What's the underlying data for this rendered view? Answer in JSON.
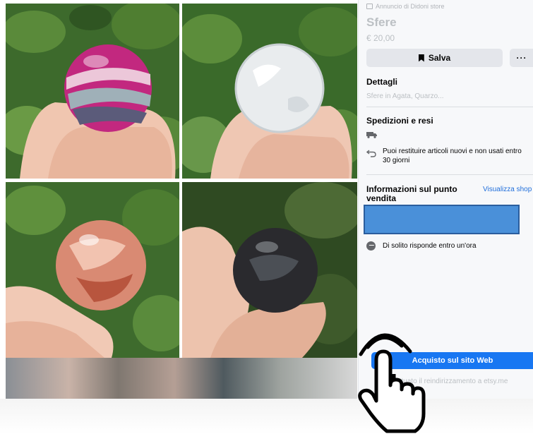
{
  "listing": {
    "seller_line": "Annuncio di Didoni store",
    "title": "Sfere",
    "price": "€ 20,00"
  },
  "actions": {
    "save_label": "Salva",
    "more_label": "···"
  },
  "details": {
    "heading": "Dettagli",
    "text": "Sfere in Agata, Quarzo..."
  },
  "shipping": {
    "heading": "Spedizioni e resi",
    "returns_text": "Puoi restituire articoli nuovi e non usati entro 30 giorni"
  },
  "store": {
    "heading": "Informazioni sul punto vendita",
    "view_shop_link": "Visualizza shop",
    "response_text": "Di solito risponde entro un'ora"
  },
  "purchase": {
    "button_label": "Acquisto sul sito Web",
    "redirect_text": "Effettuato il reindirizzamento a etsy.me"
  },
  "icons": {
    "save": "bookmark-icon",
    "shipping": "truck-icon",
    "returns": "return-arrow-icon",
    "messenger": "messenger-icon",
    "cursor": "hand-pointer-icon"
  },
  "colors": {
    "accent_blue": "#1877f2",
    "link_blue": "#216fdb",
    "panel_bg": "#f7f8fa",
    "button_gray": "#e4e6eb",
    "muted_text": "#bcc0c4"
  }
}
